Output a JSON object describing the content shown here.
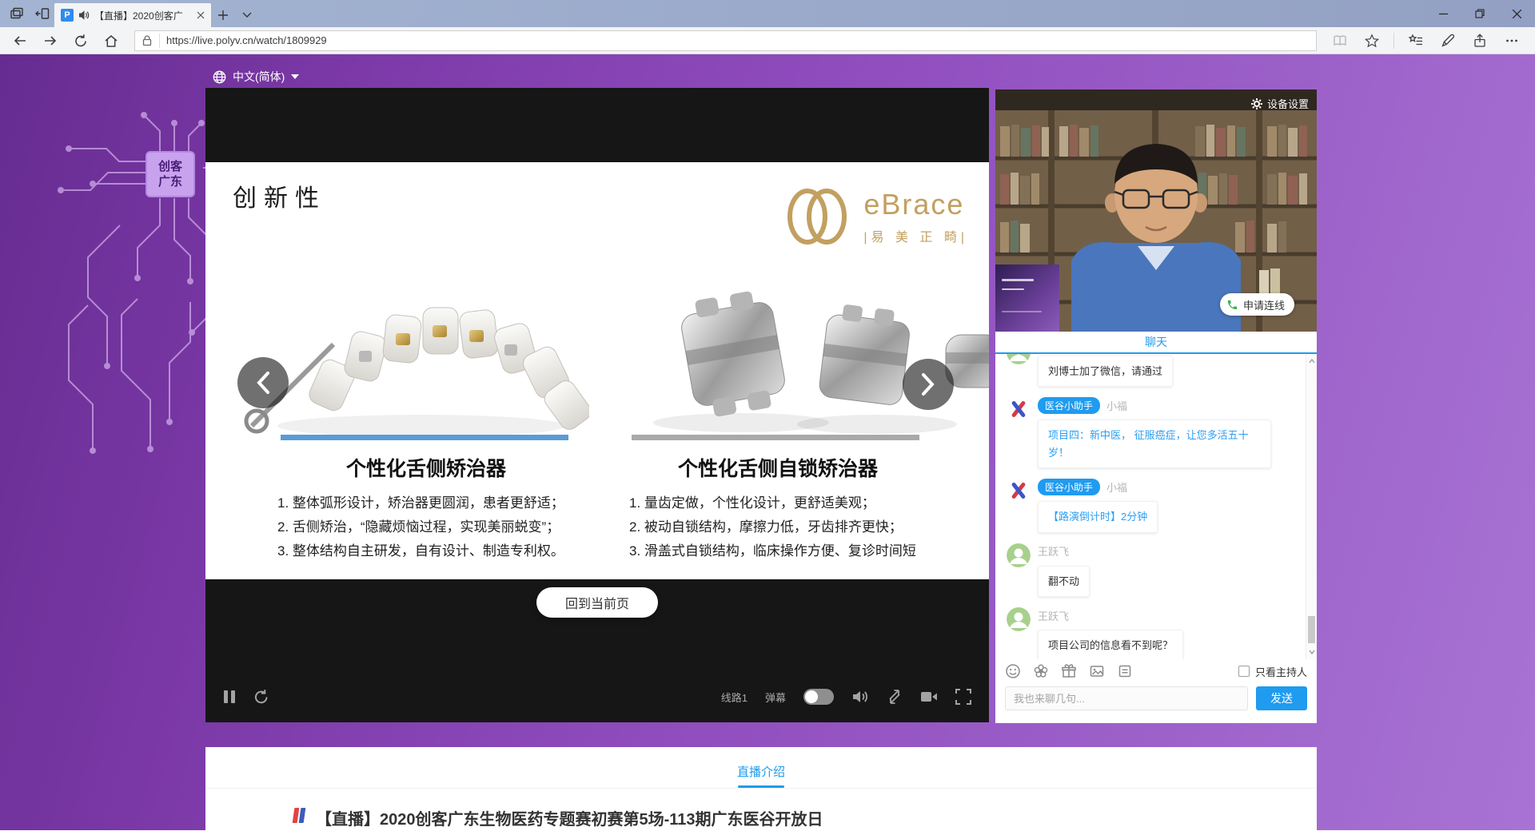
{
  "browser": {
    "tab": {
      "title": "【直播】2020创客广",
      "favicon_letter": "P"
    },
    "url": "https://live.polyv.cn/watch/1809929"
  },
  "page": {
    "language_label": "中文(简体)",
    "chip": {
      "line1": "创客",
      "line2": "广东"
    }
  },
  "player": {
    "slide": {
      "title": "创新性",
      "brand": {
        "name": "eBrace",
        "sub": "|易 美 正 畸|"
      },
      "columns": [
        {
          "title": "个性化舌侧矫治器",
          "items": [
            "1. 整体弧形设计，矫治器更圆润，患者更舒适；",
            "2. 舌侧矫治，“隐藏烦恼过程，实现美丽蜕变”；",
            "3. 整体结构自主研发，自有设计、制造专利权。"
          ]
        },
        {
          "title": "个性化舌侧自锁矫治器",
          "items": [
            "1. 量齿定做，个性化设计，更舒适美观；",
            "2. 被动自锁结构，摩擦力低，牙齿排齐更快；",
            "3. 滑盖式自锁结构，临床操作方便、复诊时间短"
          ]
        }
      ]
    },
    "back_button": "回到当前页",
    "controls": {
      "line": "线路1",
      "danmaku": "弹幕"
    }
  },
  "sidebar": {
    "device_settings": "设备设置",
    "connect_button": "申请连线",
    "chat": {
      "title": "聊天",
      "messages": [
        {
          "text": "刘博士加了微信，请通过"
        },
        {
          "badge": "医谷小助手",
          "name": "小福",
          "text": "项目四：新中医， 征服癌症，让您多活五十岁！"
        },
        {
          "badge": "医谷小助手",
          "name": "小福",
          "text": "【路演倒计时】2分钟"
        },
        {
          "name": "王跃飞",
          "text": "翻不动"
        },
        {
          "name": "王跃飞",
          "text": "项目公司的信息看不到呢？"
        }
      ],
      "only_host_label": "只看主持人",
      "input_placeholder": "我也来聊几句...",
      "send_label": "发送"
    }
  },
  "footer": {
    "tab_label": "直播介绍",
    "title": "【直播】2020创客广东生物医药专题赛初赛第5场-113期广东医谷开放日"
  },
  "colors": {
    "accent_blue": "#1f9bf0",
    "brand_gold": "#c2a061",
    "slide_rule_blue": "#5b9bd5",
    "bg_purple_dark": "#662c91",
    "bg_purple_light": "#a873d4"
  },
  "icons": {
    "tab-audio-icon": "speaker-with-waves",
    "site-info-icon": "padlock",
    "danmaku-toggle": "switch-off",
    "connect-phone-icon": "green-phone",
    "device-settings-icon": "gear",
    "only-host-checkbox": "unchecked"
  }
}
